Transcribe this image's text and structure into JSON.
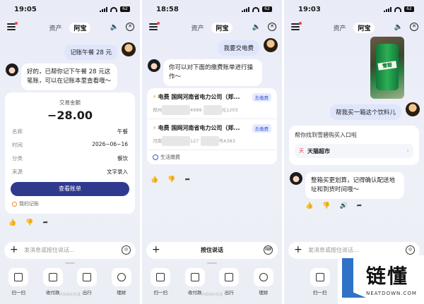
{
  "common": {
    "tab_assets": "资产",
    "tab_abao": "阿宝",
    "input_placeholder": "发消息或按住说话...",
    "hold_to_talk": "按住说话",
    "tools": [
      "扫一扫",
      "收付款",
      "出行",
      "理财"
    ],
    "footer_note": "内容由AI生成"
  },
  "phone1": {
    "time": "19:05",
    "battery": "62",
    "user_msg": "记账午餐 28 元",
    "bot_msg": "好的，已帮你记下午餐 28 元这笔账，可以在记账本里查看哦～",
    "card": {
      "amount_label": "交易金额",
      "amount": "−28.00",
      "rows": [
        {
          "k": "名称",
          "v": "午餐"
        },
        {
          "k": "时间",
          "v": "2026−06−16"
        },
        {
          "k": "分类",
          "v": "餐饮"
        },
        {
          "k": "来源",
          "v": "文字录入"
        }
      ],
      "button": "查看账单",
      "footnote": "我的记账"
    }
  },
  "phone2": {
    "time": "18:58",
    "battery": "62",
    "user_msg": "我要交电费",
    "bot_msg": "你可以对下面的缴费账单进行操作～",
    "bills": [
      {
        "title": "电费  国网河南省电力公司（郑...",
        "tag": "去缴费",
        "sub_a": "郑州",
        "sub_b": "4999",
        "sub_c": "元1203"
      },
      {
        "title": "电费  国网河南省电力公司（郑...",
        "tag": "去缴费",
        "sub_a": "河南",
        "sub_b": "127",
        "sub_c": "号A383"
      }
    ],
    "bills_footer": "生活缴费"
  },
  "phone3": {
    "time": "19:03",
    "battery": "62",
    "can_text": "雪碧",
    "user_msg": "帮我买一箱这个饮料儿",
    "store_title": "帮你找到雪碧购买入口啦",
    "store_logo": "天",
    "store_name": "天猫超市",
    "bot_msg": "整箱买更划算，记得确认配送地址和到货时间哦～"
  },
  "logo": {
    "text": "链懂",
    "sub": "NEATDOWN.COM"
  },
  "icons": {
    "bolt": "⚡",
    "sound": "🔈",
    "close": "✕",
    "like": "👍",
    "dislike": "👎",
    "share": "➦",
    "audio": "🔊",
    "plus": "+",
    "voice": "◎",
    "keyboard": "⌨",
    "chevron": "›"
  },
  "colors": {
    "accent": "#2f3a8f",
    "tag_blue": "#3b57d8",
    "bolt_orange": "#f29a1b",
    "user_bubble": "#dfe5fb",
    "logo_blue": "#2f73c9"
  }
}
